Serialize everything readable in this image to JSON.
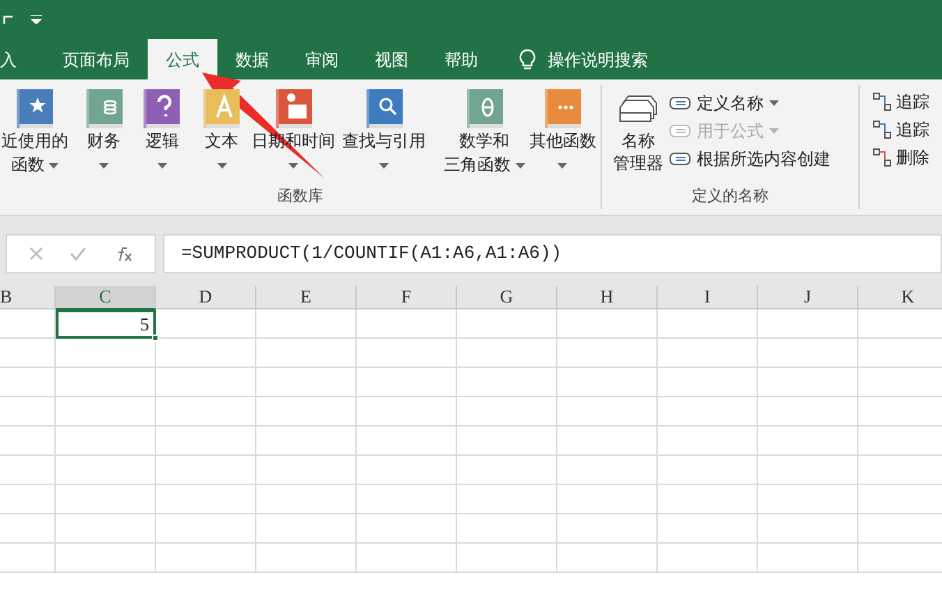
{
  "tabs": [
    {
      "label": "入",
      "selected": false
    },
    {
      "label": "页面布局",
      "selected": false
    },
    {
      "label": "公式",
      "selected": true
    },
    {
      "label": "数据",
      "selected": false
    },
    {
      "label": "审阅",
      "selected": false
    },
    {
      "label": "视图",
      "selected": false
    },
    {
      "label": "帮助",
      "selected": false
    }
  ],
  "tell_me": {
    "label": "操作说明搜索"
  },
  "function_library": {
    "title": "函数库",
    "items": [
      {
        "lines": [
          "近使用的",
          "函数"
        ]
      },
      {
        "lines": [
          "财务"
        ]
      },
      {
        "lines": [
          "逻辑"
        ]
      },
      {
        "lines": [
          "文本"
        ]
      },
      {
        "lines": [
          "日期和时间"
        ]
      },
      {
        "lines": [
          "查找与引用"
        ]
      },
      {
        "lines": [
          "数学和",
          "三角函数"
        ]
      },
      {
        "lines": [
          "其他函数"
        ]
      }
    ]
  },
  "defined_names": {
    "title": "定义的名称",
    "manager": {
      "lines": [
        "名称",
        "管理器"
      ]
    },
    "items": [
      {
        "label": "定义名称",
        "dropdown": true,
        "disabled": false
      },
      {
        "label": "用于公式",
        "dropdown": true,
        "disabled": true
      },
      {
        "label": "根据所选内容创建",
        "dropdown": false,
        "disabled": false
      }
    ]
  },
  "auditing": {
    "items": [
      {
        "label": "追踪"
      },
      {
        "label": "追踪"
      },
      {
        "label": "删除"
      }
    ]
  },
  "formula_bar": {
    "formula": "=SUMPRODUCT(1/COUNTIF(A1:A6,A1:A6))"
  },
  "sheet": {
    "columns": [
      {
        "label": "B",
        "selected": false
      },
      {
        "label": "C",
        "selected": true,
        "row_1": "5"
      },
      {
        "label": "D",
        "selected": false
      },
      {
        "label": "E",
        "selected": false
      },
      {
        "label": "F",
        "selected": false
      },
      {
        "label": "G",
        "selected": false
      },
      {
        "label": "H",
        "selected": false
      },
      {
        "label": "I",
        "selected": false
      },
      {
        "label": "J",
        "selected": false
      },
      {
        "label": "K",
        "selected": false
      }
    ]
  }
}
